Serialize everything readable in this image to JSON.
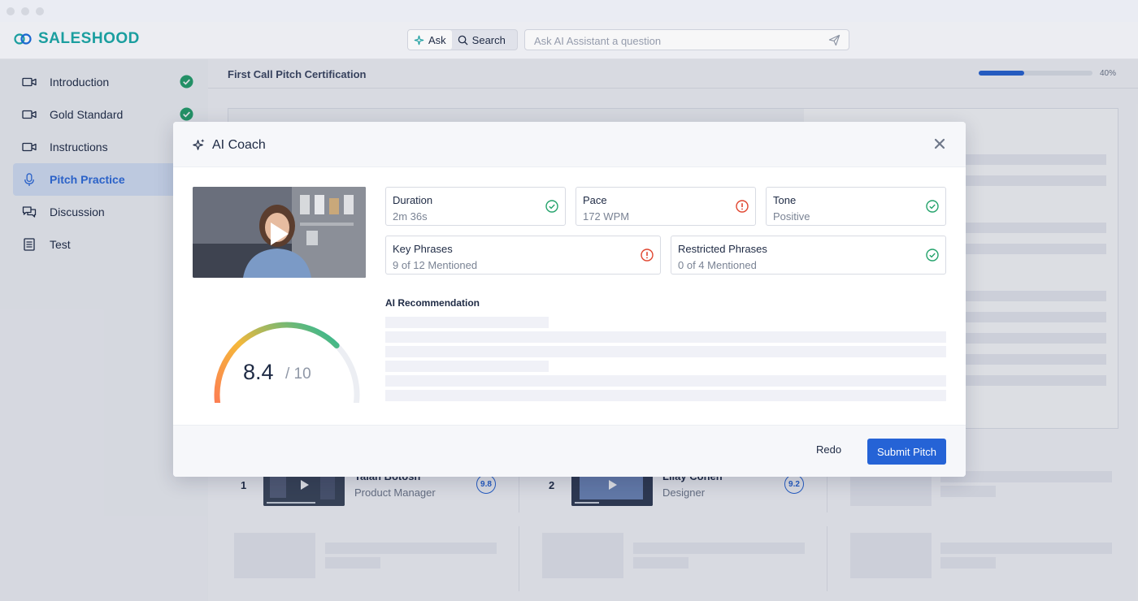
{
  "app": {
    "name": "SALESHOOD"
  },
  "header": {
    "toggle": {
      "ask_label": "Ask",
      "search_label": "Search"
    },
    "ask_placeholder": "Ask AI Assistant a question"
  },
  "sidebar": {
    "items": [
      {
        "label": "Introduction",
        "completed": true
      },
      {
        "label": "Gold Standard",
        "completed": true
      },
      {
        "label": "Instructions",
        "completed": false
      },
      {
        "label": "Pitch Practice",
        "completed": false,
        "active": true
      },
      {
        "label": "Discussion",
        "completed": false
      },
      {
        "label": "Test",
        "completed": false
      }
    ]
  },
  "main": {
    "title": "First Call Pitch Certification",
    "progress": {
      "percent": 40,
      "label": "40%"
    },
    "leaderboard": [
      {
        "rank": "1",
        "name": "Talan Botosh",
        "role": "Product Manager",
        "score": "9.8"
      },
      {
        "rank": "2",
        "name": "Lilay Cohen",
        "role": "Designer",
        "score": "9.2"
      }
    ]
  },
  "modal": {
    "title": "AI Coach",
    "metrics": [
      {
        "label": "Duration",
        "value": "2m 36s",
        "status": "ok"
      },
      {
        "label": "Pace",
        "value": "172 WPM",
        "status": "warning"
      },
      {
        "label": "Tone",
        "value": "Positive",
        "status": "ok"
      },
      {
        "label": "Key Phrases",
        "value": "9 of 12 Mentioned",
        "status": "warning"
      },
      {
        "label": "Restricted Phrases",
        "value": "0 of 4 Mentioned",
        "status": "ok"
      }
    ],
    "recommendation_title": "AI Recommendation",
    "score": {
      "value": "8.4",
      "max": "/ 10",
      "fraction": 0.84
    },
    "buttons": {
      "redo": "Redo",
      "submit": "Submit Pitch"
    }
  },
  "colors": {
    "brand": "#1aa3a3",
    "primary": "#2563d6",
    "success": "#23a26b",
    "warning": "#e0452f",
    "gauge_start": "#ff6b5a",
    "gauge_mid": "#f5b83a",
    "gauge_end": "#1fb89a"
  }
}
